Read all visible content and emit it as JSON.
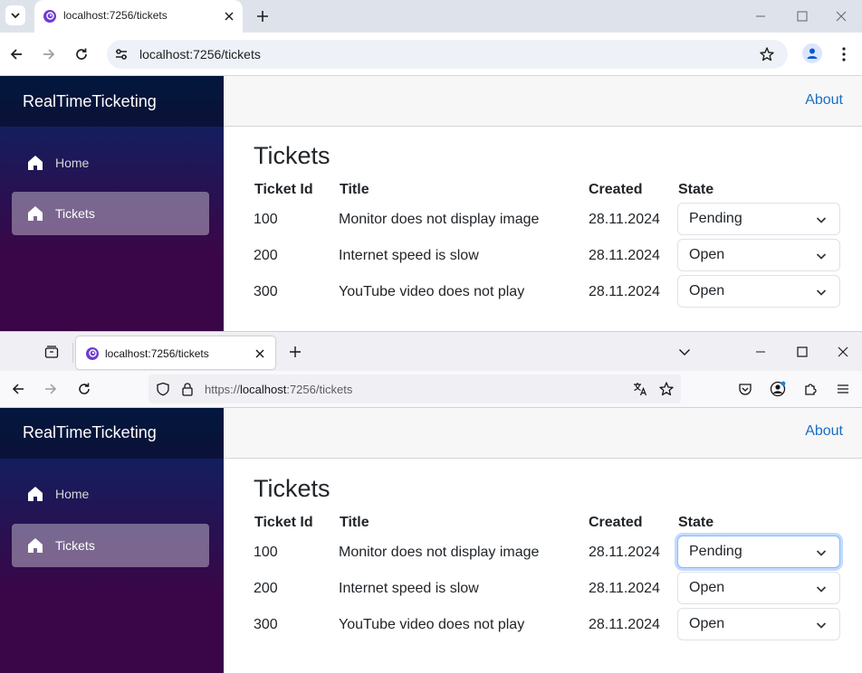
{
  "chrome": {
    "tab_title": "localhost:7256/tickets",
    "url": "localhost:7256/tickets"
  },
  "firefox": {
    "tab_title": "localhost:7256/tickets",
    "url_scheme": "https://",
    "url_host": "localhost",
    "url_rest": ":7256/tickets"
  },
  "app": {
    "brand": "RealTimeTicketing",
    "about": "About",
    "nav": [
      {
        "label": "Home",
        "icon": "home-icon"
      },
      {
        "label": "Tickets",
        "icon": "home-icon",
        "active": true
      }
    ],
    "heading": "Tickets",
    "columns": [
      "Ticket Id",
      "Title",
      "Created",
      "State"
    ],
    "rows": [
      {
        "id": "100",
        "title": "Monitor does not display image",
        "created": "28.11.2024",
        "state": "Pending"
      },
      {
        "id": "200",
        "title": "Internet speed is slow",
        "created": "28.11.2024",
        "state": "Open"
      },
      {
        "id": "300",
        "title": "YouTube video does not play",
        "created": "28.11.2024",
        "state": "Open"
      }
    ]
  },
  "colors": {
    "link": "#1b6ec2",
    "sidebar_top": "#052767",
    "sidebar_bottom": "#3a0647",
    "chrome_frame": "#dee3eb",
    "firefox_frame": "#f0f0f4"
  }
}
